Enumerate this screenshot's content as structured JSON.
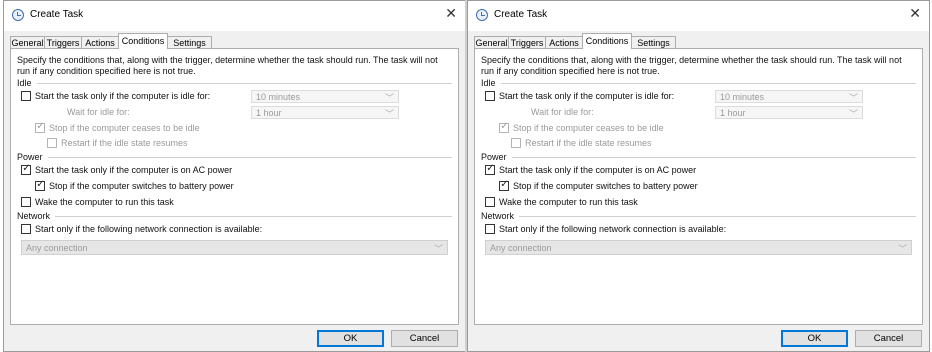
{
  "dialogs": [
    {
      "title": "Create Task",
      "close_glyph": "✕",
      "tabs": [
        {
          "label": "General",
          "active": false
        },
        {
          "label": "Triggers",
          "active": false
        },
        {
          "label": "Actions",
          "active": false
        },
        {
          "label": "Conditions",
          "active": true
        },
        {
          "label": "Settings",
          "active": false
        }
      ],
      "intro": "Specify the conditions that, along with the trigger, determine whether the task should run.  The task will not run  if any condition specified here is not true.",
      "idle": {
        "label": "Idle",
        "start_if_idle": {
          "label": "Start the task only if the computer is idle for:",
          "checked": false,
          "enabled": true
        },
        "idle_for_value": "10 minutes",
        "wait_label": "Wait for idle for:",
        "wait_value": "1 hour",
        "stop_if_ceases": {
          "label": "Stop if the computer ceases to be idle",
          "checked": true,
          "enabled": false
        },
        "restart_if_resumes": {
          "label": "Restart if the idle state resumes",
          "checked": false,
          "enabled": false
        }
      },
      "power": {
        "label": "Power",
        "ac_power": {
          "label": "Start the task only if the computer is on AC power",
          "checked": true,
          "enabled": true
        },
        "battery_stop": {
          "label": "Stop if the computer switches to battery power",
          "checked": true,
          "enabled": true
        },
        "wake": {
          "label": "Wake the computer to run this task",
          "checked": false,
          "enabled": true
        }
      },
      "network": {
        "label": "Network",
        "start_if_network": {
          "label": "Start only if the following network connection is available:",
          "checked": false,
          "enabled": true
        },
        "connection_value": "Any connection"
      },
      "buttons": {
        "ok": "OK",
        "cancel": "Cancel"
      }
    },
    {
      "title": "Create Task",
      "close_glyph": "✕",
      "tabs": [
        {
          "label": "General",
          "active": false
        },
        {
          "label": "Triggers",
          "active": false
        },
        {
          "label": "Actions",
          "active": false
        },
        {
          "label": "Conditions",
          "active": true
        },
        {
          "label": "Settings",
          "active": false
        }
      ],
      "intro": "Specify the conditions that, along with the trigger, determine whether the task should run.  The task will not run  if any condition specified here is not true.",
      "idle": {
        "label": "Idle",
        "start_if_idle": {
          "label": "Start the task only if the computer is idle for:",
          "checked": false,
          "enabled": true
        },
        "idle_for_value": "10 minutes",
        "wait_label": "Wait for idle for:",
        "wait_value": "1 hour",
        "stop_if_ceases": {
          "label": "Stop if the computer ceases to be idle",
          "checked": true,
          "enabled": false
        },
        "restart_if_resumes": {
          "label": "Restart if the idle state resumes",
          "checked": false,
          "enabled": false
        }
      },
      "power": {
        "label": "Power",
        "ac_power": {
          "label": "Start the task only if the computer is on AC power",
          "checked": true,
          "enabled": true
        },
        "battery_stop": {
          "label": "Stop if the computer switches to battery power",
          "checked": true,
          "enabled": true
        },
        "wake": {
          "label": "Wake the computer to run this task",
          "checked": false,
          "enabled": true
        }
      },
      "network": {
        "label": "Network",
        "start_if_network": {
          "label": "Start only if the following network connection is available:",
          "checked": false,
          "enabled": true
        },
        "connection_value": "Any connection"
      },
      "buttons": {
        "ok": "OK",
        "cancel": "Cancel"
      }
    }
  ],
  "icons": {
    "app": "task-scheduler-clock-icon",
    "close": "close-icon",
    "dropdown": "chevron-down-icon",
    "check": "checkmark-icon"
  },
  "colors": {
    "window": "#f0f0f0",
    "panel": "#ffffff",
    "accent": "#0078d7",
    "disabled_text": "#9a9a9a"
  }
}
